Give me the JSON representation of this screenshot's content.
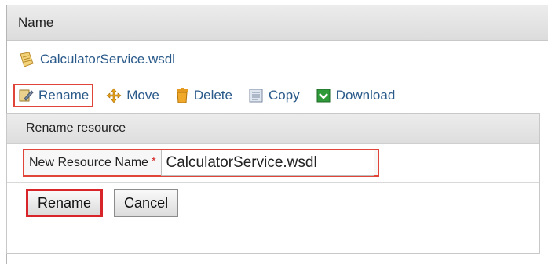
{
  "header": {
    "title": "Name"
  },
  "file": {
    "name": "CalculatorService.wsdl"
  },
  "actions": [
    {
      "label": "Rename",
      "icon": "rename-icon"
    },
    {
      "label": "Move",
      "icon": "move-icon"
    },
    {
      "label": "Delete",
      "icon": "trash-icon"
    },
    {
      "label": "Copy",
      "icon": "copy-icon"
    },
    {
      "label": "Download",
      "icon": "download-icon"
    }
  ],
  "rename_panel": {
    "title": "Rename resource",
    "field_label": "New Resource Name",
    "required_mark": "*",
    "field_value": "CalculatorService.wsdl",
    "rename_button": "Rename",
    "cancel_button": "Cancel"
  },
  "colors": {
    "link": "#2a5a8a",
    "highlight": "#e0453a"
  }
}
